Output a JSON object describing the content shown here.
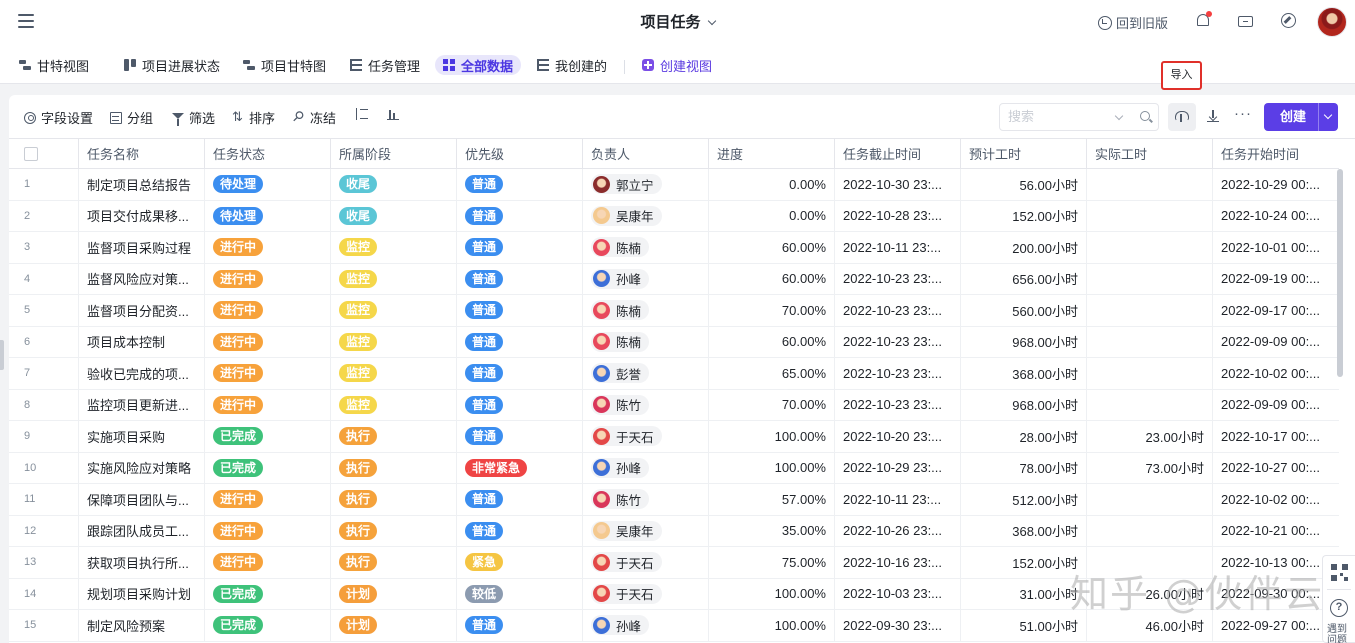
{
  "header": {
    "title": "项目任务",
    "back_to_old": "回到旧版",
    "icons": [
      "menu-icon",
      "history-icon",
      "bell-icon",
      "inbox-icon",
      "compass-icon",
      "avatar"
    ]
  },
  "views": [
    {
      "label": "甘特视图",
      "icon": "gantt-icon"
    },
    {
      "label": "项目进展状态",
      "icon": "kanban-icon"
    },
    {
      "label": "项目甘特图",
      "icon": "gantt-icon"
    },
    {
      "label": "任务管理",
      "icon": "table-icon"
    },
    {
      "label": "全部数据",
      "icon": "grid-icon",
      "active": true
    },
    {
      "label": "我创建的",
      "icon": "table-icon"
    },
    {
      "label": "创建视图",
      "icon": "plus-icon"
    }
  ],
  "tooltip": "导入",
  "toolbar": {
    "field_settings": "字段设置",
    "group": "分组",
    "filter": "筛选",
    "sort": "排序",
    "freeze": "冻结",
    "search_placeholder": "搜索",
    "create_label": "创建"
  },
  "columns": [
    "任务名称",
    "任务状态",
    "所属阶段",
    "优先级",
    "负责人",
    "进度",
    "任务截止时间",
    "预计工时",
    "实际工时",
    "任务开始时间"
  ],
  "colors": {
    "待处理": "#3b8ef0",
    "进行中": "#f7a23b",
    "已完成": "#3ec27a",
    "收尾": "#5bc6d6",
    "监控": "#f5d74a",
    "执行": "#f5a23b",
    "计划": "#f59e3b",
    "普通": "#3b8ef0",
    "非常紧急": "#ef4444",
    "紧急": "#f5c542",
    "较低": "#8c9bb0",
    "accent": "#5b3ee6"
  },
  "rows": [
    {
      "no": "1",
      "name": "制定项目总结报告",
      "status": "待处理",
      "stage": "收尾",
      "priority": "普通",
      "owner": "郭立宁",
      "avatar": "#8b2c2c",
      "progress": "0.00%",
      "due": "2022-10-30 23:...",
      "est": "56.00小时",
      "actual": "",
      "start": "2022-10-29 00:..."
    },
    {
      "no": "2",
      "name": "项目交付成果移...",
      "status": "待处理",
      "stage": "收尾",
      "priority": "普通",
      "owner": "吴康年",
      "avatar": "#f4c98f",
      "progress": "0.00%",
      "due": "2022-10-28 23:...",
      "est": "152.00小时",
      "actual": "",
      "start": "2022-10-24 00:..."
    },
    {
      "no": "3",
      "name": "监督项目采购过程",
      "status": "进行中",
      "stage": "监控",
      "priority": "普通",
      "owner": "陈楠",
      "avatar": "#e8485c",
      "progress": "60.00%",
      "due": "2022-10-11 23:...",
      "est": "200.00小时",
      "actual": "",
      "start": "2022-10-01 00:..."
    },
    {
      "no": "4",
      "name": "监督风险应对策...",
      "status": "进行中",
      "stage": "监控",
      "priority": "普通",
      "owner": "孙峰",
      "avatar": "#3d6fd8",
      "progress": "60.00%",
      "due": "2022-10-23 23:...",
      "est": "656.00小时",
      "actual": "",
      "start": "2022-09-19 00:..."
    },
    {
      "no": "5",
      "name": "监督项目分配资...",
      "status": "进行中",
      "stage": "监控",
      "priority": "普通",
      "owner": "陈楠",
      "avatar": "#e8485c",
      "progress": "70.00%",
      "due": "2022-10-23 23:...",
      "est": "560.00小时",
      "actual": "",
      "start": "2022-09-17 00:..."
    },
    {
      "no": "6",
      "name": "项目成本控制",
      "status": "进行中",
      "stage": "监控",
      "priority": "普通",
      "owner": "陈楠",
      "avatar": "#e8485c",
      "progress": "60.00%",
      "due": "2022-10-23 23:...",
      "est": "968.00小时",
      "actual": "",
      "start": "2022-09-09 00:..."
    },
    {
      "no": "7",
      "name": "验收已完成的项...",
      "status": "进行中",
      "stage": "监控",
      "priority": "普通",
      "owner": "彭誉",
      "avatar": "#3d6fd8",
      "progress": "65.00%",
      "due": "2022-10-23 23:...",
      "est": "368.00小时",
      "actual": "",
      "start": "2022-10-02 00:..."
    },
    {
      "no": "8",
      "name": "监控项目更新进...",
      "status": "进行中",
      "stage": "监控",
      "priority": "普通",
      "owner": "陈竹",
      "avatar": "#d9365a",
      "progress": "70.00%",
      "due": "2022-10-23 23:...",
      "est": "968.00小时",
      "actual": "",
      "start": "2022-09-09 00:..."
    },
    {
      "no": "9",
      "name": "实施项目采购",
      "status": "已完成",
      "stage": "执行",
      "priority": "普通",
      "owner": "于天石",
      "avatar": "#e34848",
      "progress": "100.00%",
      "due": "2022-10-20 23:...",
      "est": "28.00小时",
      "actual": "23.00小时",
      "start": "2022-10-17 00:..."
    },
    {
      "no": "10",
      "name": "实施风险应对策略",
      "status": "已完成",
      "stage": "执行",
      "priority": "非常紧急",
      "owner": "孙峰",
      "avatar": "#3d6fd8",
      "progress": "100.00%",
      "due": "2022-10-29 23:...",
      "est": "78.00小时",
      "actual": "73.00小时",
      "start": "2022-10-27 00:..."
    },
    {
      "no": "11",
      "name": "保障项目团队与...",
      "status": "进行中",
      "stage": "执行",
      "priority": "普通",
      "owner": "陈竹",
      "avatar": "#d9365a",
      "progress": "57.00%",
      "due": "2022-10-11 23:...",
      "est": "512.00小时",
      "actual": "",
      "start": "2022-10-02 00:..."
    },
    {
      "no": "12",
      "name": "跟踪团队成员工...",
      "status": "进行中",
      "stage": "执行",
      "priority": "普通",
      "owner": "吴康年",
      "avatar": "#f4c98f",
      "progress": "35.00%",
      "due": "2022-10-26 23:...",
      "est": "368.00小时",
      "actual": "",
      "start": "2022-10-21 00:..."
    },
    {
      "no": "13",
      "name": "获取项目执行所...",
      "status": "进行中",
      "stage": "执行",
      "priority": "紧急",
      "owner": "于天石",
      "avatar": "#e34848",
      "progress": "75.00%",
      "due": "2022-10-16 23:...",
      "est": "152.00小时",
      "actual": "",
      "start": "2022-10-13 00:..."
    },
    {
      "no": "14",
      "name": "规划项目采购计划",
      "status": "已完成",
      "stage": "计划",
      "priority": "较低",
      "owner": "于天石",
      "avatar": "#e34848",
      "progress": "100.00%",
      "due": "2022-10-03 23:...",
      "est": "31.00小时",
      "actual": "26.00小时",
      "start": "2022-09-30 00:..."
    },
    {
      "no": "15",
      "name": "制定风险预案",
      "status": "已完成",
      "stage": "计划",
      "priority": "普通",
      "owner": "孙峰",
      "avatar": "#3d6fd8",
      "progress": "100.00%",
      "due": "2022-09-30 23:...",
      "est": "51.00小时",
      "actual": "46.00小时",
      "start": "2022-09-27 00:..."
    }
  ],
  "help": {
    "label": "遇到问题"
  },
  "watermark": "知乎 @伙伴云"
}
